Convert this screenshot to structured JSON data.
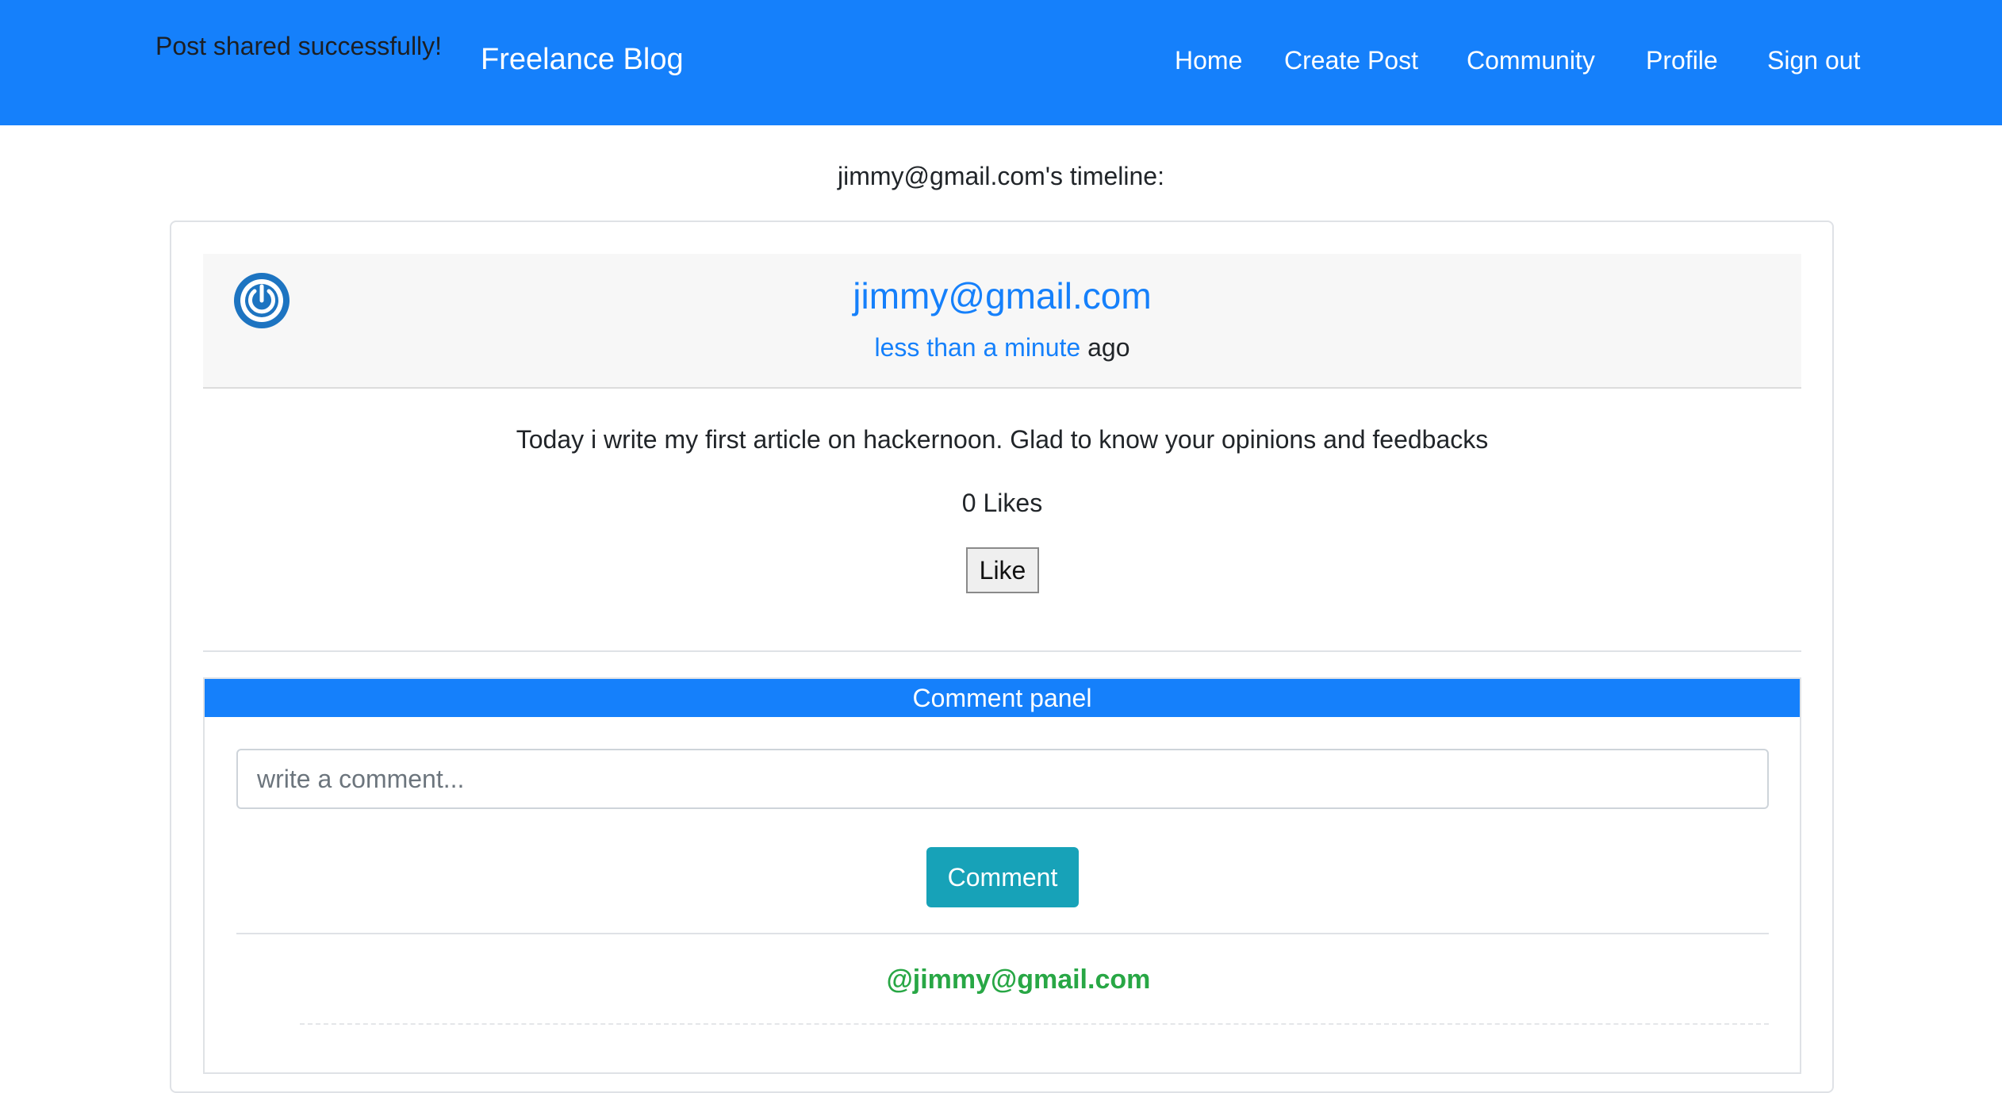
{
  "flash": {
    "message": "Post shared successfully!"
  },
  "navbar": {
    "brand": "Freelance Blog",
    "links": [
      {
        "label": "Home"
      },
      {
        "label": "Create Post"
      },
      {
        "label": "Community"
      },
      {
        "label": "Profile"
      },
      {
        "label": "Sign out"
      }
    ],
    "background_color": "#1580fb"
  },
  "timeline": {
    "title": "jimmy@gmail.com's timeline:"
  },
  "post": {
    "avatar_icon": "power-icon",
    "author": "jimmy@gmail.com",
    "time_link": "less than a minute",
    "time_suffix": " ago",
    "text": "Today i write my first article on hackernoon. Glad to know your opinions and feedbacks",
    "likes_text": "0 Likes",
    "like_button": "Like"
  },
  "comments": {
    "panel_title": "Comment panel",
    "input_placeholder": "write a comment...",
    "input_value": "",
    "submit_label": "Comment",
    "items": [
      {
        "author": "@jimmy@gmail.com"
      }
    ]
  },
  "colors": {
    "primary": "#1580fb",
    "info_button": "#17a2b8",
    "comment_author": "#28a745"
  }
}
